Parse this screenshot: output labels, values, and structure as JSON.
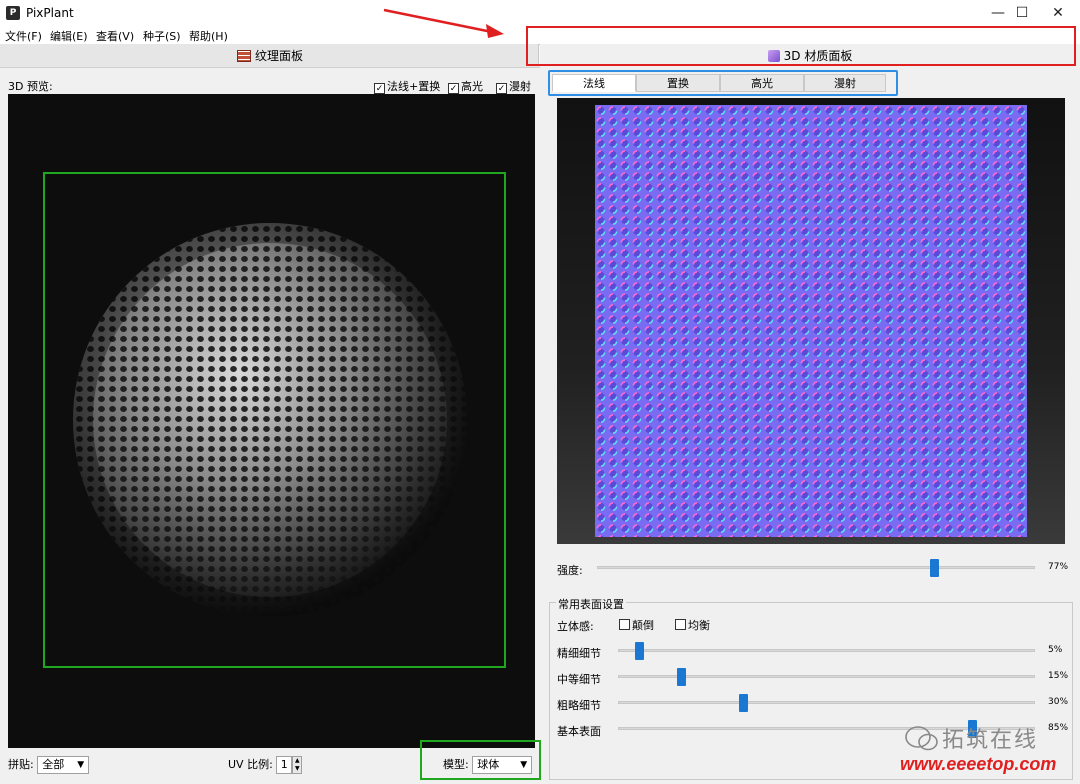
{
  "window": {
    "title": "PixPlant",
    "icon_letter": "P"
  },
  "menu": [
    "文件(F)",
    "编辑(E)",
    "查看(V)",
    "种子(S)",
    "帮助(H)"
  ],
  "panels": {
    "left_tab": "纹理面板",
    "right_tab": "3D 材质面板"
  },
  "preview": {
    "label": "3D 预览:",
    "checks": [
      {
        "label": "法线+置换",
        "checked": true
      },
      {
        "label": "高光",
        "checked": true
      },
      {
        "label": "漫射",
        "checked": true
      }
    ]
  },
  "bottom": {
    "tile_label": "拼贴:",
    "tile_value": "全部",
    "uv_label": "UV 比例:",
    "uv_value": "1",
    "model_label": "模型:",
    "model_value": "球体"
  },
  "material_tabs": [
    "法线",
    "置换",
    "高光",
    "漫射"
  ],
  "strength": {
    "label": "强度:",
    "value": 0.77,
    "value_text": "77%"
  },
  "surface": {
    "title": "常用表面设置",
    "stereo_label": "立体感:",
    "invert_label": "颠倒",
    "balance_label": "均衡",
    "sliders": [
      {
        "label": "精细细节",
        "value": 0.05,
        "value_text": "5%"
      },
      {
        "label": "中等细节",
        "value": 0.15,
        "value_text": "15%"
      },
      {
        "label": "粗略细节",
        "value": 0.3,
        "value_text": "30%"
      },
      {
        "label": "基本表面",
        "value": 0.85,
        "value_text": "85%"
      }
    ]
  },
  "watermark": {
    "text": "拓筑在线",
    "url": "www.eeeetop.com"
  },
  "colors": {
    "red_box": "#e02020",
    "green_box": "#1fa81f",
    "blue_box": "#2f8fe6",
    "slider_thumb": "#1a78d2"
  }
}
